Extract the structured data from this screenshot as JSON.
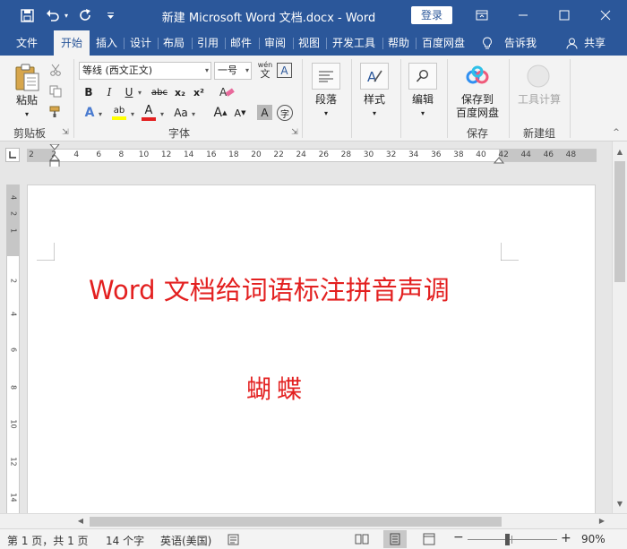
{
  "titlebar": {
    "title": "新建 Microsoft Word 文档.docx  -  Word",
    "login_label": "登录",
    "icons": [
      "save-icon",
      "undo-icon",
      "redo-icon",
      "customize-qat-icon",
      "ribbon-display-icon",
      "minimize-icon",
      "maximize-icon",
      "close-icon"
    ]
  },
  "tabs": [
    {
      "label": "文件"
    },
    {
      "label": "开始",
      "active": true
    },
    {
      "label": "插入"
    },
    {
      "label": "设计"
    },
    {
      "label": "布局"
    },
    {
      "label": "引用"
    },
    {
      "label": "邮件"
    },
    {
      "label": "审阅"
    },
    {
      "label": "视图"
    },
    {
      "label": "开发工具"
    },
    {
      "label": "帮助"
    },
    {
      "label": "百度网盘"
    }
  ],
  "tell_me": "告诉我",
  "share": "共享",
  "ribbon": {
    "clipboard": {
      "paste_label": "粘贴",
      "group_label": "剪贴板"
    },
    "font": {
      "font_name": "等线 (西文正文)",
      "font_size": "一号",
      "group_label": "字体",
      "pinyin_icon_text": "wén",
      "pinyin_icon_char": "文",
      "border_char": "A",
      "bold": "B",
      "italic": "I",
      "underline": "U",
      "strike": "abc",
      "subscript": "x₂",
      "superscript": "x²",
      "text_effects": "A",
      "highlight": "ab",
      "font_color": "A",
      "change_case": "Aa",
      "grow": "A",
      "shrink": "A",
      "char_shading": "A",
      "enclose": "字"
    },
    "paragraph": {
      "label": "段落"
    },
    "styles": {
      "label": "样式"
    },
    "editing": {
      "label": "编辑"
    },
    "save_to_baidu": {
      "line1": "保存到",
      "line2": "百度网盘",
      "group_label": "保存"
    },
    "toolcalc": {
      "label": "工具计算",
      "group_label": "新建组"
    }
  },
  "ruler": {
    "corner": "L",
    "h_numbers": [
      "2",
      "2",
      "4",
      "6",
      "8",
      "10",
      "12",
      "14",
      "16",
      "18",
      "20",
      "22",
      "24",
      "26",
      "28",
      "30",
      "32",
      "34",
      "36",
      "38",
      "40",
      "42",
      "44",
      "46",
      "48"
    ],
    "v_numbers": [
      "4",
      "2",
      "1",
      "2",
      "4",
      "6",
      "8",
      "10",
      "12",
      "14"
    ]
  },
  "document": {
    "title": "Word 文档给词语标注拼音声调",
    "word": "蝴蝶",
    "text_color": "#e32020"
  },
  "status": {
    "page": "第 1 页，共 1 页",
    "word_count": "14 个字",
    "language": "英语(美国)",
    "zoom_minus": "−",
    "zoom_plus": "+",
    "zoom": "90%"
  },
  "colors": {
    "brand": "#2b579a",
    "highlight": "#ffff00",
    "font_color": "#e32020"
  }
}
